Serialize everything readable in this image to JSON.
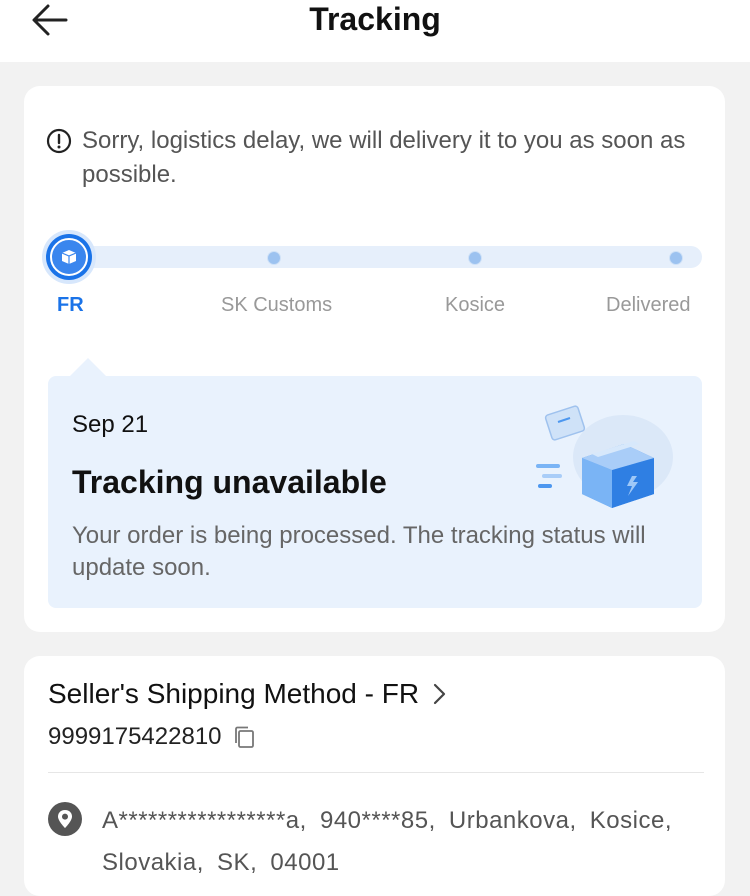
{
  "header": {
    "title": "Tracking",
    "back_label": "back"
  },
  "notice": {
    "icon": "exclamation-circle-icon",
    "text": "Sorry, logistics delay, we will delivery it to you as soon as possible."
  },
  "progress": {
    "steps": [
      {
        "label": "FR",
        "active": true
      },
      {
        "label": "SK Customs",
        "active": false
      },
      {
        "label": "Kosice",
        "active": false
      },
      {
        "label": "Delivered",
        "active": false
      }
    ],
    "colors": {
      "active": "#1a73e8",
      "inactive": "#999999",
      "track": "#e6effb"
    }
  },
  "detail": {
    "date": "Sep 21",
    "title": "Tracking unavailable",
    "description": "Your order is being processed. The tracking status will update soon."
  },
  "shipping": {
    "method": "Seller's Shipping Method - FR",
    "tracking_number": "9999175422810",
    "address": "A*****************a, 940****85, Urbankova, Kosice, Slovakia, SK, 04001"
  }
}
